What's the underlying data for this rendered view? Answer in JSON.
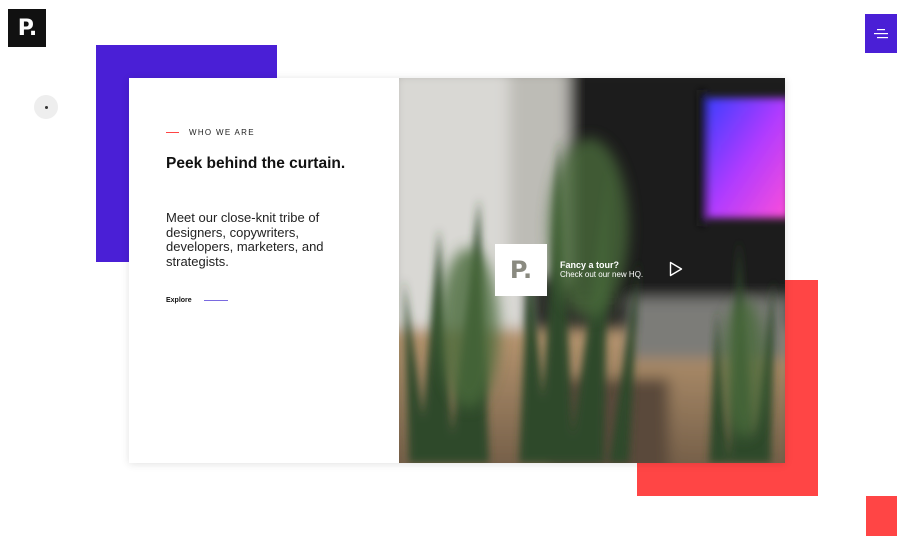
{
  "brand": {
    "logo_text": "P.",
    "menu_icon": "hamburger-menu-icon",
    "accent_purple": "#4a1fd6",
    "accent_red": "#ff4545"
  },
  "intro": {
    "eyebrow": "WHO WE ARE",
    "headline": "Peek behind the curtain.",
    "body": "Meet our close-knit tribe of designers, copywriters, developers, marketers, and strategists.",
    "cta": "Explore"
  },
  "video": {
    "logo_text": "P.",
    "title": "Fancy a tour?",
    "subtitle": "Check out our new HQ.",
    "play_icon": "play-triangle-icon"
  }
}
